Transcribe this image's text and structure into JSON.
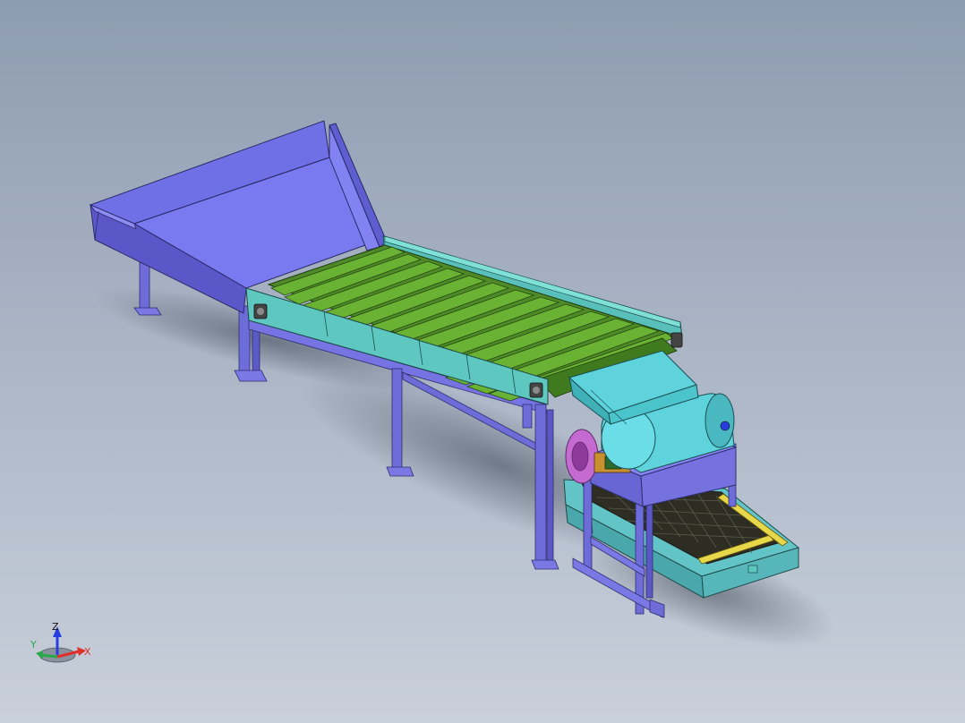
{
  "triad": {
    "x_label": "X",
    "y_label": "Y",
    "z_label": "Z",
    "x_color": "#e0302a",
    "y_color": "#2aa84a",
    "z_color": "#2a3ee0"
  },
  "colors": {
    "background_top": "#8e9cb1",
    "background_bottom": "#c9d0db",
    "hopper": "#7272e8",
    "frame": "#7a78e4",
    "conveyor_side": "#5fc9c2",
    "slats": "#5e9a2c",
    "crusher": "#5ed3dc",
    "screen": "#6fcfd2",
    "mesh": "#2d2d24",
    "rail_accent": "#e7d84a",
    "wheel": "#c46ad0"
  }
}
